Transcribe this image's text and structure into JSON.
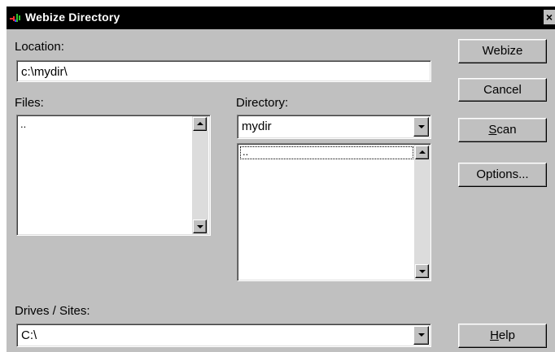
{
  "window": {
    "title": "Webize Directory",
    "close_glyph": "×"
  },
  "location": {
    "label": "Location:",
    "value": "c:\\mydir\\"
  },
  "files": {
    "label": "Files:",
    "items": [
      ".."
    ]
  },
  "directory": {
    "label": "Directory:",
    "selected": "mydir",
    "items": [
      ".."
    ]
  },
  "drives": {
    "label": "Drives / Sites:",
    "selected": "C:\\"
  },
  "buttons": {
    "webize": "Webize",
    "cancel": "Cancel",
    "scan_mnemonic": "S",
    "scan_rest": "can",
    "options": "Options...",
    "help_mnemonic": "H",
    "help_rest": "elp"
  },
  "colors": {
    "face": "#c0c0c0",
    "titlebar": "#000000"
  }
}
